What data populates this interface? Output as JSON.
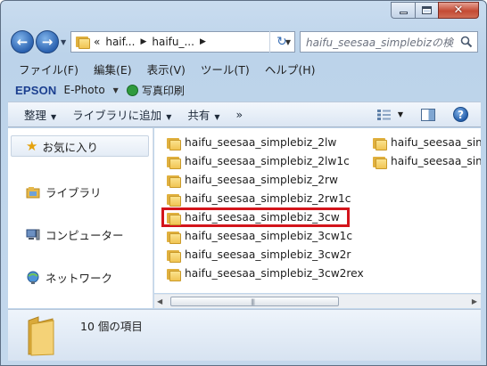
{
  "window": {
    "minimize_label": "minimize",
    "maximize_label": "maximize",
    "close_label": "close"
  },
  "address": {
    "crumbs": [
      "«",
      "haif...",
      "haifu_..."
    ],
    "search_placeholder": "haifu_seesaa_simplebizの検索"
  },
  "menu": [
    "ファイル(F)",
    "編集(E)",
    "表示(V)",
    "ツール(T)",
    "ヘルプ(H)"
  ],
  "epson": {
    "logo": "EPSON",
    "app": "E-Photo",
    "print_label": "写真印刷"
  },
  "toolbar": {
    "organize": "整理",
    "library": "ライブラリに追加",
    "share": "共有",
    "more": "»"
  },
  "nav": {
    "favorites": "お気に入り",
    "libraries": "ライブラリ",
    "computer": "コンピューター",
    "network": "ネットワーク"
  },
  "files": [
    "haifu_seesaa_simplebiz_2lw",
    "haifu_seesaa_simplebiz_2lw1c",
    "haifu_seesaa_simplebiz_2rw",
    "haifu_seesaa_simplebiz_2rw1c",
    "haifu_seesaa_simplebiz_3cw",
    "haifu_seesaa_simplebiz_3cw1c",
    "haifu_seesaa_simplebiz_3cw2r",
    "haifu_seesaa_simplebiz_3cw2rex"
  ],
  "files_col2": [
    "haifu_seesaa_sim",
    "haifu_seesaa_sim"
  ],
  "details": {
    "count": "10 個の項目"
  }
}
